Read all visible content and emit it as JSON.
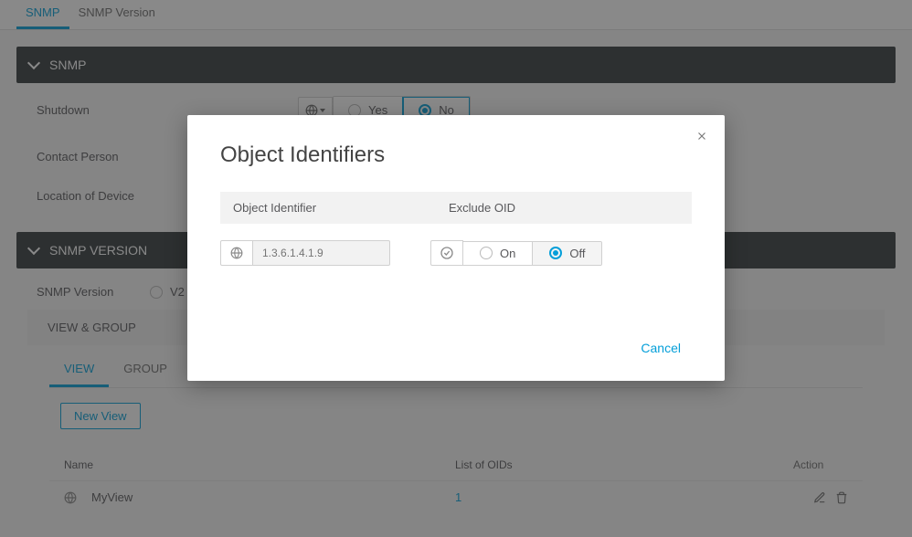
{
  "tabs": {
    "snmp": "SNMP",
    "snmp_version": "SNMP Version"
  },
  "sections": {
    "snmp_header": "SNMP",
    "snmp_version_header": "SNMP VERSION",
    "view_group": "VIEW & GROUP"
  },
  "form": {
    "shutdown_label": "Shutdown",
    "contact_label": "Contact Person",
    "location_label": "Location of Device",
    "yes": "Yes",
    "no": "No",
    "version_label": "SNMP Version",
    "v2": "V2"
  },
  "inner_tabs": {
    "view": "VIEW",
    "group": "GROUP"
  },
  "buttons": {
    "new_view": "New View"
  },
  "table": {
    "header_name": "Name",
    "header_oids": "List of OIDs",
    "header_action": "Action",
    "rows": [
      {
        "name": "MyView",
        "oids": "1"
      }
    ]
  },
  "modal": {
    "title": "Object Identifiers",
    "col_identifier": "Object Identifier",
    "col_exclude": "Exclude OID",
    "placeholder": "1.3.6.1.4.1.9",
    "on": "On",
    "off": "Off",
    "cancel": "Cancel"
  }
}
